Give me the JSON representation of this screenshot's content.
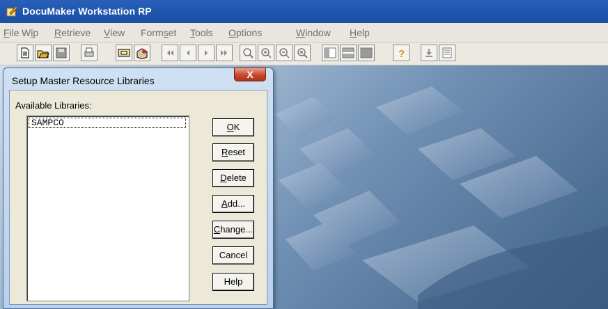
{
  "window": {
    "title": "DocuMaker Workstation RP"
  },
  "menu": [
    {
      "pre": "",
      "u": "F",
      "post": "ile"
    },
    {
      "pre": "W",
      "u": "i",
      "post": "p"
    },
    {
      "pre": "",
      "u": "R",
      "post": "etrieve"
    },
    {
      "pre": "",
      "u": "V",
      "post": "iew"
    },
    {
      "pre": "Form",
      "u": "s",
      "post": "et"
    },
    {
      "pre": "",
      "u": "T",
      "post": "ools"
    },
    {
      "pre": "",
      "u": "O",
      "post": "ptions"
    },
    {
      "pre": "",
      "u": "W",
      "post": "indow"
    },
    {
      "pre": "",
      "u": "H",
      "post": "elp"
    }
  ],
  "toolbar": {
    "icons": [
      "new-icon",
      "open-icon",
      "save-icon",
      "print-icon",
      "image-icon",
      "import-icon",
      "first-page-icon",
      "previous-page-icon",
      "next-page-icon",
      "last-page-icon",
      "zoom-icon",
      "zoom-in-icon",
      "zoom-out-icon",
      "zoom-fit-icon",
      "layout-left-icon",
      "layout-split-icon",
      "layout-full-icon",
      "help-icon",
      "download-icon",
      "properties-icon"
    ]
  },
  "dialog": {
    "title": "Setup Master Resource Libraries",
    "close_label": "X",
    "list_label": "Available Libraries:",
    "libraries": [
      "SAMPCO"
    ],
    "buttons": {
      "ok": {
        "pre": "",
        "u": "O",
        "post": "K"
      },
      "reset": {
        "pre": "",
        "u": "R",
        "post": "eset"
      },
      "delete": {
        "pre": "",
        "u": "D",
        "post": "elete"
      },
      "add": {
        "pre": "",
        "u": "A",
        "post": "dd..."
      },
      "change": {
        "pre": "",
        "u": "C",
        "post": "hange..."
      },
      "cancel": {
        "pre": "Cancel",
        "u": "",
        "post": ""
      },
      "help": {
        "pre": "Help",
        "u": "",
        "post": ""
      }
    }
  }
}
